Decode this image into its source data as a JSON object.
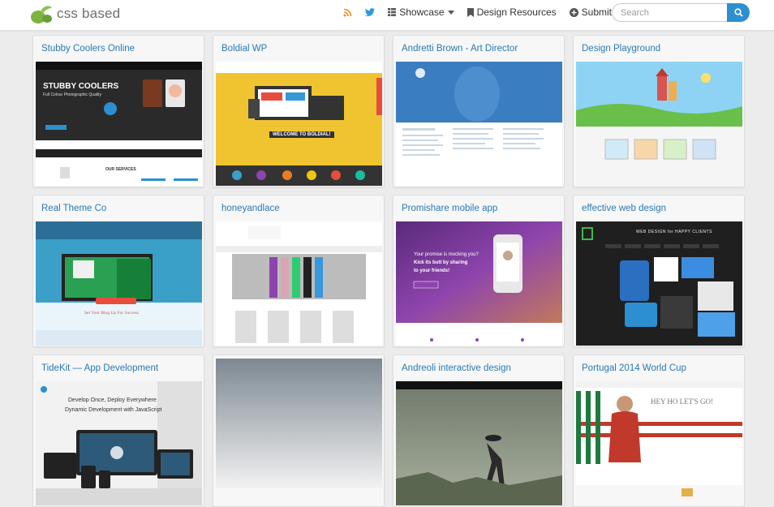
{
  "header": {
    "logo_text": "css based",
    "nav": [
      {
        "label": "",
        "icon": "rss-icon"
      },
      {
        "label": "",
        "icon": "twitter-icon"
      },
      {
        "label": "Showcase",
        "icon": "grid-icon"
      },
      {
        "label": "Design Resources",
        "icon": "bookmark-icon"
      },
      {
        "label": "Submit",
        "icon": "plus-circle-icon"
      }
    ],
    "search_placeholder": "Search"
  },
  "cards": [
    {
      "title": "Stubby Coolers Online"
    },
    {
      "title": "Boldial WP"
    },
    {
      "title": "Andretti Brown - Art Director"
    },
    {
      "title": "Design Playground"
    },
    {
      "title": "Real Theme Co"
    },
    {
      "title": "honeyandlace"
    },
    {
      "title": "Promishare mobile app"
    },
    {
      "title": "effective web design"
    },
    {
      "title": "TideKit — App Development"
    },
    {
      "title": ""
    },
    {
      "title": "Andreoli interactive design"
    },
    {
      "title": "Portugal 2014 World Cup"
    }
  ],
  "thumb_text": {
    "stubby_heading": "STUBBY COOLERS",
    "stubby_sub": "Full Colour Photographic Quality",
    "stubby_services": "OUR SERVICES",
    "boldial_welcome": "WELCOME TO BOLDIAL!",
    "real_signup": "Set Your Blog Up For Success",
    "promishare_line1": "Your promise is mocking you?",
    "promishare_line2": "Kick its butt by sharing",
    "promishare_line3": "to your friends!",
    "tidekit_line1": "Develop Once, Deploy Everywhere",
    "tidekit_line2": "Dynamic Development with JavaScript",
    "portugal_hey": "HEY HO LET'S GO!",
    "effective_heading": "WEB DESIGN for HAPPY CLIENTS"
  },
  "colors": {
    "link": "#2a7ab4",
    "search_button": "#2b8fd0",
    "logo_green": "#6aa84f"
  }
}
